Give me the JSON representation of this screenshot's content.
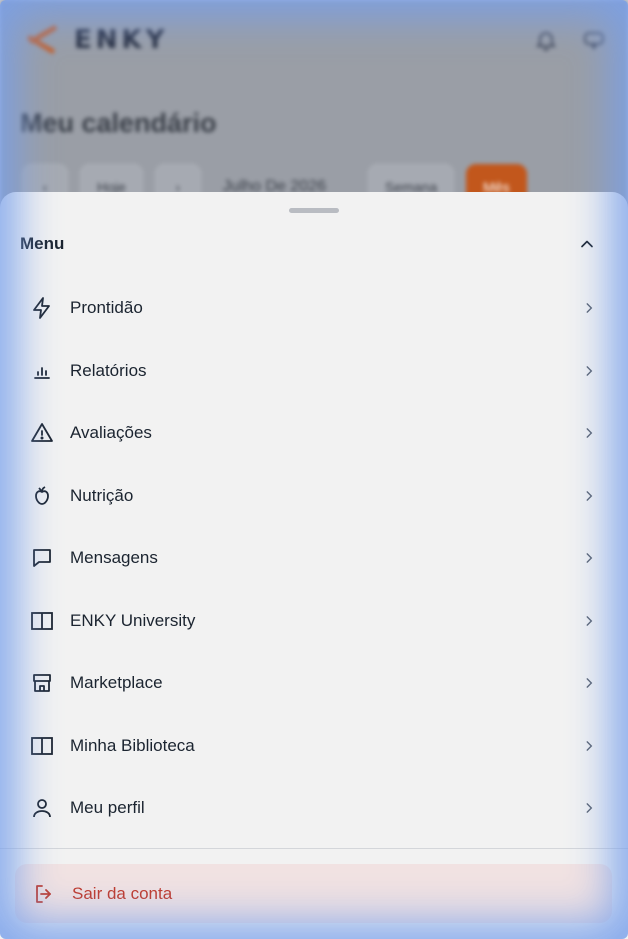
{
  "background": {
    "brand": "ENKY",
    "title": "Meu calendário",
    "controls": {
      "today": "Hoje",
      "date_range": "Julho De 2026",
      "week": "Semana",
      "month": "Mês"
    },
    "icons": [
      "bell-icon",
      "chat-icon"
    ],
    "accent_color": "#c2571c"
  },
  "sheet": {
    "title": "Menu",
    "items": [
      {
        "label": "Prontidão",
        "icon": "lightning-icon"
      },
      {
        "label": "Relatórios",
        "icon": "bar-chart-icon"
      },
      {
        "label": "Avaliações",
        "icon": "warning-icon"
      },
      {
        "label": "Nutrição",
        "icon": "fruit-icon"
      },
      {
        "label": "Mensagens",
        "icon": "message-icon"
      },
      {
        "label": "ENKY University",
        "icon": "book-icon"
      },
      {
        "label": "Marketplace",
        "icon": "store-icon"
      },
      {
        "label": "Minha Biblioteca",
        "icon": "library-icon"
      },
      {
        "label": "Meu perfil",
        "icon": "user-icon"
      }
    ],
    "logout": {
      "label": "Sair da conta",
      "icon": "logout-icon",
      "color": "#c0392b"
    }
  }
}
